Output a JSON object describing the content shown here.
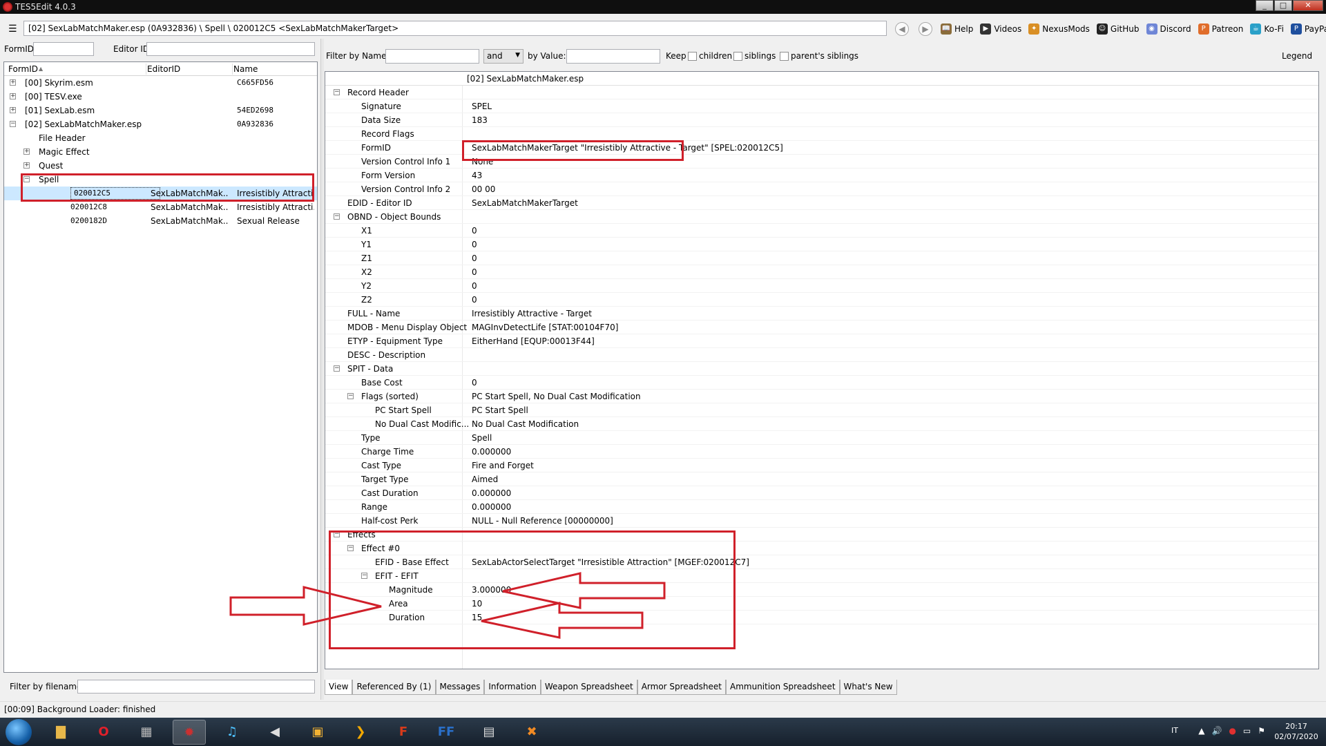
{
  "window": {
    "title": "TES5Edit 4.0.3",
    "minimize": "_",
    "maximize": "□",
    "close": "✕"
  },
  "toolbar": {
    "menu": "☰",
    "path": "[02] SexLabMatchMaker.esp (0A932836) \\ Spell \\ 020012C5 <SexLabMatchMakerTarget>",
    "back": "◀",
    "forward": "▶",
    "links": [
      {
        "label": "Help",
        "icon": "book-icon",
        "color": "#8a6d3b",
        "glyph": "📖"
      },
      {
        "label": "Videos",
        "icon": "video-icon",
        "color": "#333333",
        "glyph": "▶"
      },
      {
        "label": "NexusMods",
        "icon": "nexus-icon",
        "color": "#d98f25",
        "glyph": "✦"
      },
      {
        "label": "GitHub",
        "icon": "github-icon",
        "color": "#222222",
        "glyph": "☺"
      },
      {
        "label": "Discord",
        "icon": "discord-icon",
        "color": "#6f86d6",
        "glyph": "◉"
      },
      {
        "label": "Patreon",
        "icon": "patreon-icon",
        "color": "#e06d2b",
        "glyph": "P"
      },
      {
        "label": "Ko-Fi",
        "icon": "kofi-icon",
        "color": "#2aa0c8",
        "glyph": "☕"
      },
      {
        "label": "PayPal",
        "icon": "paypal-icon",
        "color": "#1f4f9e",
        "glyph": "P"
      }
    ]
  },
  "left": {
    "formid_label": "FormID",
    "editorid_label": "Editor ID",
    "columns": {
      "formid": "FormID",
      "sort": "▲",
      "editorid": "EditorID",
      "name": "Name"
    },
    "rows": [
      {
        "indent": 0,
        "exp": "+",
        "formid": "[00] Skyrim.esm",
        "editorid": "",
        "name": "C665FD56"
      },
      {
        "indent": 0,
        "exp": "+",
        "formid": "[00] TESV.exe",
        "editorid": "",
        "name": ""
      },
      {
        "indent": 0,
        "exp": "+",
        "formid": "[01] SexLab.esm",
        "editorid": "",
        "name": "54ED2698"
      },
      {
        "indent": 0,
        "exp": "−",
        "formid": "[02] SexLabMatchMaker.esp",
        "editorid": "",
        "name": "0A932836"
      },
      {
        "indent": 1,
        "exp": "",
        "formid": "File Header",
        "editorid": "",
        "name": ""
      },
      {
        "indent": 1,
        "exp": "+",
        "formid": "Magic Effect",
        "editorid": "",
        "name": ""
      },
      {
        "indent": 1,
        "exp": "+",
        "formid": "Quest",
        "editorid": "",
        "name": ""
      },
      {
        "indent": 1,
        "exp": "−",
        "formid": "Spell",
        "editorid": "",
        "name": ""
      },
      {
        "indent": 2,
        "exp": "",
        "formid": "020012C5",
        "editorid": "SexLabMatchMak...",
        "name": "Irresistibly Attracti...",
        "selected": true,
        "mono": true
      },
      {
        "indent": 2,
        "exp": "",
        "formid": "020012C8",
        "editorid": "SexLabMatchMak...",
        "name": "Irresistibly Attracti...",
        "mono": true
      },
      {
        "indent": 2,
        "exp": "",
        "formid": "0200182D",
        "editorid": "SexLabMatchMak...",
        "name": "Sexual Release",
        "mono": true
      }
    ],
    "filename_label": "Filter by filename:"
  },
  "right": {
    "filter_name_label": "Filter by Name:",
    "and_value": "and",
    "by_value_label": "by Value:",
    "keep_label": "Keep",
    "children_label": "children",
    "siblings_label": "siblings",
    "parents_siblings_label": "parent's siblings",
    "legend_label": "Legend",
    "file_header": "[02] SexLabMatchMaker.esp",
    "rows": [
      {
        "indent": 0,
        "exp": "−",
        "key": "Record Header",
        "value": ""
      },
      {
        "indent": 1,
        "exp": "",
        "key": "Signature",
        "value": "SPEL"
      },
      {
        "indent": 1,
        "exp": "",
        "key": "Data Size",
        "value": "183"
      },
      {
        "indent": 1,
        "exp": "",
        "key": "Record Flags",
        "value": ""
      },
      {
        "indent": 1,
        "exp": "",
        "key": "FormID",
        "value": "SexLabMatchMakerTarget \"Irresistibly Attractive - Target\" [SPEL:020012C5]"
      },
      {
        "indent": 1,
        "exp": "",
        "key": "Version Control Info 1",
        "value": "None"
      },
      {
        "indent": 1,
        "exp": "",
        "key": "Form Version",
        "value": "43"
      },
      {
        "indent": 1,
        "exp": "",
        "key": "Version Control Info 2",
        "value": "00 00"
      },
      {
        "indent": 0,
        "exp": "",
        "key": "EDID - Editor ID",
        "value": "SexLabMatchMakerTarget"
      },
      {
        "indent": 0,
        "exp": "−",
        "key": "OBND - Object Bounds",
        "value": ""
      },
      {
        "indent": 1,
        "exp": "",
        "key": "X1",
        "value": "0"
      },
      {
        "indent": 1,
        "exp": "",
        "key": "Y1",
        "value": "0"
      },
      {
        "indent": 1,
        "exp": "",
        "key": "Z1",
        "value": "0"
      },
      {
        "indent": 1,
        "exp": "",
        "key": "X2",
        "value": "0"
      },
      {
        "indent": 1,
        "exp": "",
        "key": "Y2",
        "value": "0"
      },
      {
        "indent": 1,
        "exp": "",
        "key": "Z2",
        "value": "0"
      },
      {
        "indent": 0,
        "exp": "",
        "key": "FULL - Name",
        "value": "Irresistibly Attractive - Target"
      },
      {
        "indent": 0,
        "exp": "",
        "key": "MDOB - Menu Display Object",
        "value": "MAGInvDetectLife [STAT:00104F70]"
      },
      {
        "indent": 0,
        "exp": "",
        "key": "ETYP - Equipment Type",
        "value": "EitherHand [EQUP:00013F44]"
      },
      {
        "indent": 0,
        "exp": "",
        "key": "DESC - Description",
        "value": ""
      },
      {
        "indent": 0,
        "exp": "−",
        "key": "SPIT - Data",
        "value": ""
      },
      {
        "indent": 1,
        "exp": "",
        "key": "Base Cost",
        "value": "0"
      },
      {
        "indent": 1,
        "exp": "−",
        "key": "Flags (sorted)",
        "value": "PC Start Spell, No Dual Cast Modification"
      },
      {
        "indent": 2,
        "exp": "",
        "key": "PC Start Spell",
        "value": "PC Start Spell"
      },
      {
        "indent": 2,
        "exp": "",
        "key": "No Dual Cast Modific...",
        "value": "No Dual Cast Modification"
      },
      {
        "indent": 1,
        "exp": "",
        "key": "Type",
        "value": "Spell"
      },
      {
        "indent": 1,
        "exp": "",
        "key": "Charge Time",
        "value": "0.000000"
      },
      {
        "indent": 1,
        "exp": "",
        "key": "Cast Type",
        "value": "Fire and Forget"
      },
      {
        "indent": 1,
        "exp": "",
        "key": "Target Type",
        "value": "Aimed"
      },
      {
        "indent": 1,
        "exp": "",
        "key": "Cast Duration",
        "value": "0.000000"
      },
      {
        "indent": 1,
        "exp": "",
        "key": "Range",
        "value": "0.000000"
      },
      {
        "indent": 1,
        "exp": "",
        "key": "Half-cost Perk",
        "value": "NULL - Null Reference [00000000]"
      },
      {
        "indent": 0,
        "exp": "−",
        "key": "Effects",
        "value": ""
      },
      {
        "indent": 1,
        "exp": "−",
        "key": "Effect #0",
        "value": ""
      },
      {
        "indent": 2,
        "exp": "",
        "key": "EFID - Base Effect",
        "value": "SexLabActorSelectTarget \"Irresistible Attraction\" [MGEF:020012C7]"
      },
      {
        "indent": 2,
        "exp": "−",
        "key": "EFIT - EFIT",
        "value": ""
      },
      {
        "indent": 3,
        "exp": "",
        "key": "Magnitude",
        "value": "3.000000"
      },
      {
        "indent": 3,
        "exp": "",
        "key": "Area",
        "value": "10"
      },
      {
        "indent": 3,
        "exp": "",
        "key": "Duration",
        "value": "15"
      }
    ],
    "tabs": [
      {
        "label": "View",
        "active": true
      },
      {
        "label": "Referenced By (1)"
      },
      {
        "label": "Messages"
      },
      {
        "label": "Information"
      },
      {
        "label": "Weapon Spreadsheet"
      },
      {
        "label": "Armor Spreadsheet"
      },
      {
        "label": "Ammunition Spreadsheet"
      },
      {
        "label": "What's New"
      }
    ]
  },
  "status": {
    "text": "[00:09] Background Loader: finished"
  },
  "taskbar": {
    "apps": [
      {
        "name": "explorer-icon",
        "glyph": "▇",
        "color": "#e8b84a"
      },
      {
        "name": "opera-icon",
        "glyph": "O",
        "color": "#e0202a"
      },
      {
        "name": "media-icon",
        "glyph": "▦",
        "color": "#bbbbbb"
      },
      {
        "name": "tes5edit-icon",
        "glyph": "✹",
        "color": "#cc3030",
        "active": true
      },
      {
        "name": "music-icon",
        "glyph": "♫",
        "color": "#4fc3ff"
      },
      {
        "name": "audio-icon",
        "glyph": "◀",
        "color": "#dddddd"
      },
      {
        "name": "notes-icon",
        "glyph": "▣",
        "color": "#f2b233"
      },
      {
        "name": "arrow-app-icon",
        "glyph": "❯",
        "color": "#f2a800"
      },
      {
        "name": "filezilla-icon",
        "glyph": "F",
        "color": "#d83a1a"
      },
      {
        "name": "ffdec-icon",
        "glyph": "FF",
        "color": "#2a6fc8"
      },
      {
        "name": "window-app-icon",
        "glyph": "▤",
        "color": "#dddddd"
      },
      {
        "name": "tool-icon",
        "glyph": "✖",
        "color": "#f08a24"
      }
    ],
    "lang": "IT",
    "time": "20:17",
    "date": "02/07/2020"
  }
}
